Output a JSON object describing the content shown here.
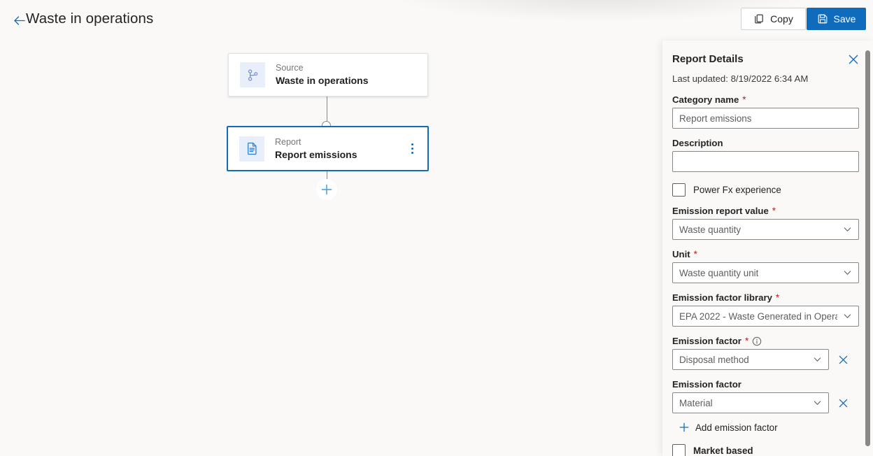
{
  "header": {
    "back_icon": "arrow-left-icon",
    "title": "Waste in operations",
    "copy_label": "Copy",
    "copy_icon": "copy-icon",
    "save_label": "Save",
    "save_icon": "save-icon"
  },
  "canvas": {
    "nodes": [
      {
        "kind": "Source",
        "title": "Waste in operations",
        "icon": "source-branch-icon",
        "selected": false,
        "has_menu": false
      },
      {
        "kind": "Report",
        "title": "Report emissions",
        "icon": "document-icon",
        "selected": true,
        "has_menu": true,
        "menu_icon": "more-vertical-icon"
      }
    ],
    "add_step_icon": "plus-icon"
  },
  "panel": {
    "title": "Report Details",
    "close_icon": "close-icon",
    "last_updated": "Last updated: 8/19/2022 6:34 AM",
    "fields": {
      "category_name": {
        "label": "Category name",
        "required": true,
        "value": "Report emissions"
      },
      "description": {
        "label": "Description",
        "required": false,
        "value": ""
      },
      "power_fx": {
        "label": "Power Fx experience",
        "checked": false
      },
      "emission_report_value": {
        "label": "Emission report value",
        "required": true,
        "value": "Waste quantity"
      },
      "unit": {
        "label": "Unit",
        "required": true,
        "value": "Waste quantity unit"
      },
      "emission_factor_library": {
        "label": "Emission factor library",
        "required": true,
        "value": "EPA 2022 - Waste Generated in Opera..."
      },
      "emission_factor_1": {
        "label": "Emission factor",
        "required": true,
        "info_icon": "info-icon",
        "value": "Disposal method",
        "clear_icon": "close-icon"
      },
      "emission_factor_2": {
        "label": "Emission factor",
        "required": false,
        "value": "Material",
        "clear_icon": "close-icon"
      },
      "add_emission_factor": {
        "label": "Add emission factor",
        "icon": "plus-icon"
      },
      "market_based": {
        "label": "Market based",
        "checked": false
      }
    }
  },
  "colors": {
    "accent": "#0f6cbd",
    "required": "#a4262c",
    "canvas_bg": "#faf9f8",
    "node_icon_bg": "#e8effa"
  }
}
